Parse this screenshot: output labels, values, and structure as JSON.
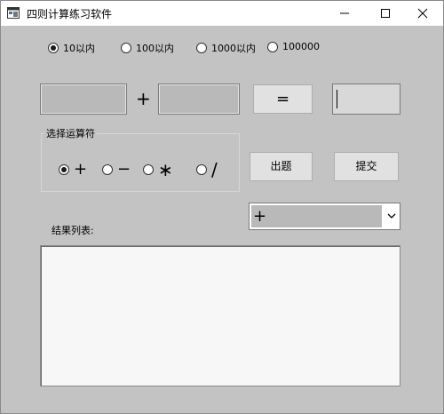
{
  "window": {
    "title": "四则计算练习软件",
    "minimize": "minimize",
    "maximize": "maximize",
    "close": "close"
  },
  "range": {
    "options": [
      "10以内",
      "100以内",
      "1000以内",
      "100000"
    ],
    "selected": "10以内"
  },
  "equation": {
    "operand1": "",
    "operator": "+",
    "operand2": "",
    "equals_label": "=",
    "answer": ""
  },
  "operator_group": {
    "title": "选择运算符",
    "options": [
      "+",
      "−",
      "∗",
      "/"
    ],
    "selected": "+"
  },
  "buttons": {
    "generate": "出题",
    "submit": "提交"
  },
  "combo": {
    "value": "+"
  },
  "results": {
    "label": "结果列表:"
  },
  "icons": {
    "app": "app-icon",
    "combo_arrow": "chevron-down-icon"
  }
}
